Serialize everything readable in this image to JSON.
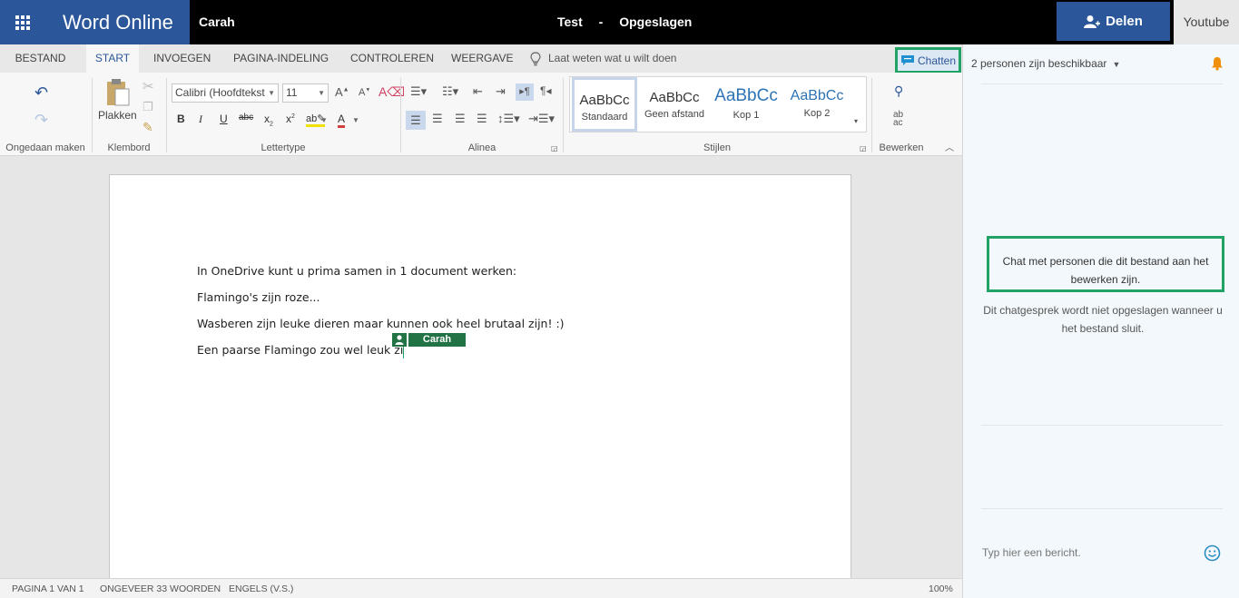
{
  "app": {
    "name": "Word Online",
    "user": "Carah",
    "document_title": "Test",
    "title_separator": "-",
    "save_status": "Opgeslagen",
    "share_label": "Delen",
    "other_tab": "Youtube"
  },
  "tabs": [
    {
      "label": "BESTAND",
      "active": false
    },
    {
      "label": "START",
      "active": true
    },
    {
      "label": "INVOEGEN",
      "active": false
    },
    {
      "label": "PAGINA-INDELING",
      "active": false
    },
    {
      "label": "CONTROLEREN",
      "active": false
    },
    {
      "label": "WEERGAVE",
      "active": false
    }
  ],
  "tell_me": "Laat weten wat u wilt doen",
  "chat_button": "Chatten",
  "ribbon": {
    "groups": {
      "undo": "Ongedaan maken",
      "clipboard": "Klembord",
      "font": "Lettertype",
      "paragraph": "Alinea",
      "styles": "Stijlen",
      "editing": "Bewerken"
    },
    "paste_label": "Plakken",
    "font_name": "Calibri (Hoofdtekst",
    "font_size": "11",
    "styles": [
      {
        "sample": "AaBbCc",
        "name": "Standaard",
        "selected": true
      },
      {
        "sample": "AaBbCc",
        "name": "Geen afstand",
        "selected": false
      },
      {
        "sample": "AaBbCc",
        "name": "Kop 1",
        "selected": false
      },
      {
        "sample": "AaBbCc",
        "name": "Kop 2",
        "selected": false
      }
    ]
  },
  "document": {
    "paragraphs": [
      "In OneDrive kunt u prima samen in 1 document werken:",
      "Flamingo's zijn roze...",
      "Wasberen zijn leuke dieren maar kunnen ook heel brutaal zijn! :)",
      "Een paarse Flamingo zou wel leuk zi"
    ],
    "presence_user": "Carah"
  },
  "status": {
    "page": "PAGINA 1 VAN 1",
    "words": "ONGEVEER 33 WOORDEN",
    "language": "ENGELS (V.S.)",
    "zoom": "100%"
  },
  "chat": {
    "people_available": "2 personen zijn beschikbaar",
    "info": "Chat met personen die dit bestand aan het bewerken zijn.",
    "note": "Dit chatgesprek wordt niet opgeslagen wanneer u het bestand sluit.",
    "input_placeholder": "Typ hier een bericht."
  },
  "colors": {
    "brand": "#2b579a",
    "highlight": "#21a366",
    "presence": "#217346",
    "chat_link": "#2b8dc2"
  }
}
